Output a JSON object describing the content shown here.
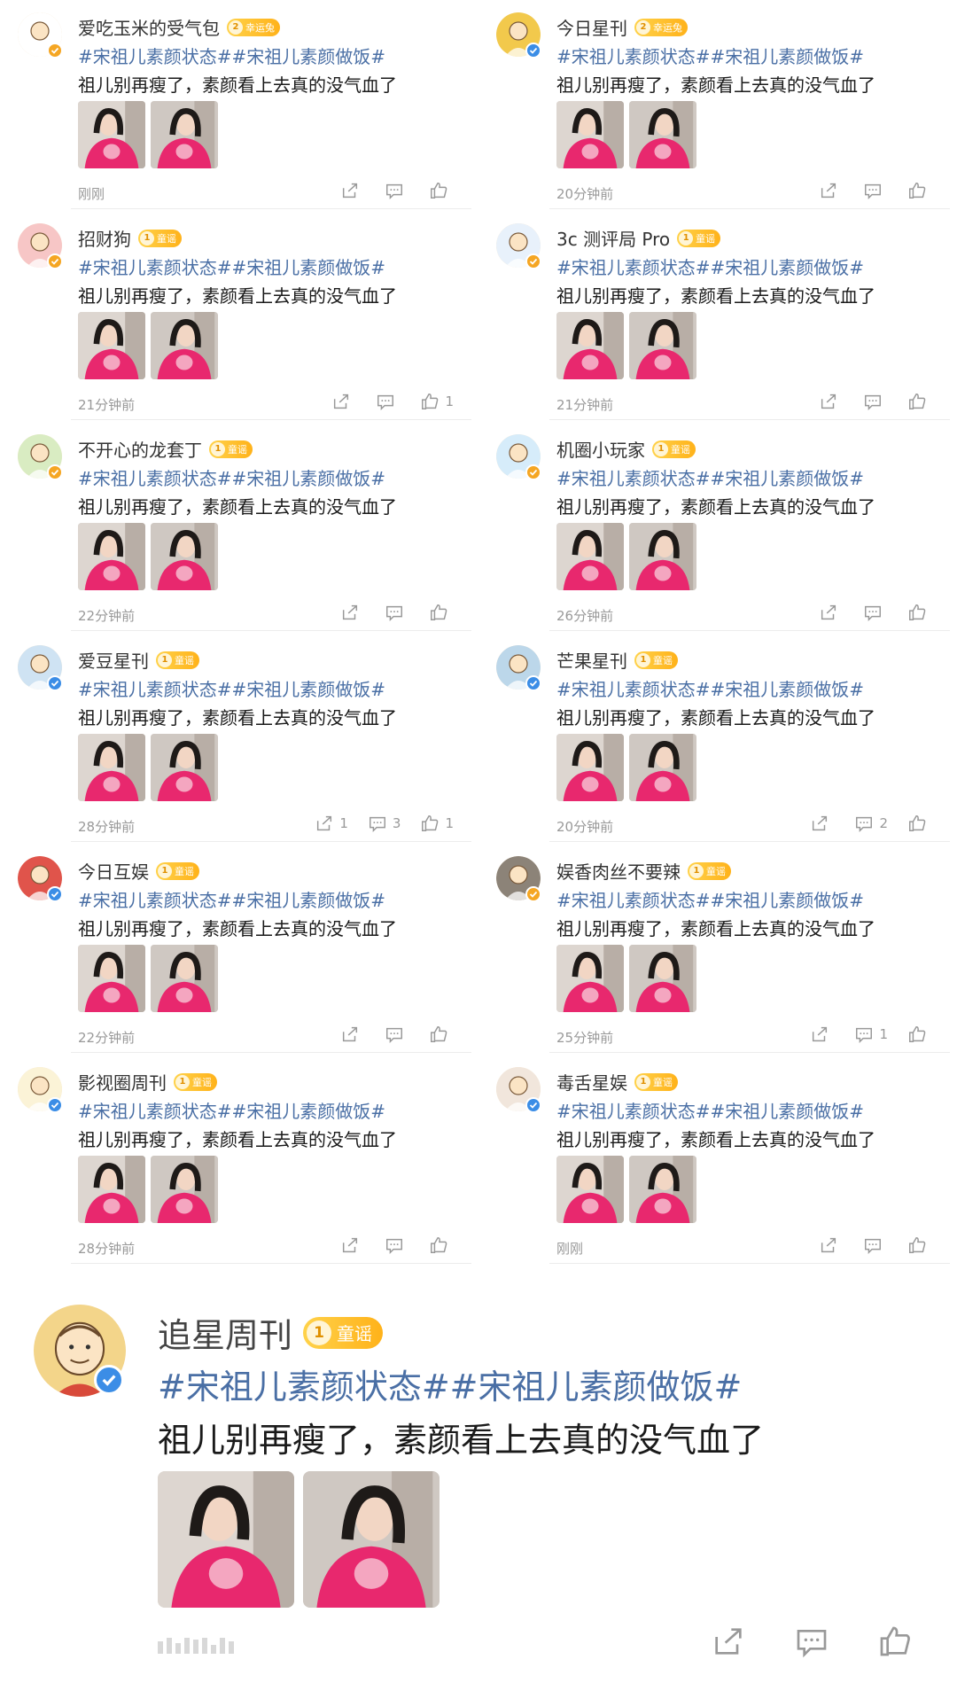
{
  "posts": [
    {
      "name": "爱吃玉米的受气包",
      "badge": "幸运兔",
      "badge_level": "2",
      "hashtags": "#宋祖儿素颜状态##宋祖儿素颜做饭#",
      "text": "祖儿别再瘦了，素颜看上去真的没气血了",
      "time": "刚刚",
      "share": "",
      "comment": "",
      "like": "",
      "avatar_color": "#ffffff",
      "verify": "gold"
    },
    {
      "name": "今日星刊",
      "badge": "幸运兔",
      "badge_level": "2",
      "hashtags": "#宋祖儿素颜状态##宋祖儿素颜做饭#",
      "text": "祖儿别再瘦了，素颜看上去真的没气血了",
      "time": "20分钟前",
      "share": "",
      "comment": "",
      "like": "",
      "avatar_color": "#f2c94c",
      "verify": "blue"
    },
    {
      "name": "招财狗",
      "badge": "童谣",
      "badge_level": "1",
      "hashtags": "#宋祖儿素颜状态##宋祖儿素颜做饭#",
      "text": "祖儿别再瘦了，素颜看上去真的没气血了",
      "time": "21分钟前",
      "share": "",
      "comment": "",
      "like": "1",
      "avatar_color": "#f7c6c6",
      "verify": "gold"
    },
    {
      "name": "3c 测评局 Pro",
      "badge": "童谣",
      "badge_level": "1",
      "hashtags": "#宋祖儿素颜状态##宋祖儿素颜做饭#",
      "text": "祖儿别再瘦了，素颜看上去真的没气血了",
      "time": "21分钟前",
      "share": "",
      "comment": "",
      "like": "",
      "avatar_color": "#e8f1fb",
      "verify": "gold"
    },
    {
      "name": "不开心的龙套丁",
      "badge": "童谣",
      "badge_level": "1",
      "hashtags": "#宋祖儿素颜状态##宋祖儿素颜做饭#",
      "text": "祖儿别再瘦了，素颜看上去真的没气血了",
      "time": "22分钟前",
      "share": "",
      "comment": "",
      "like": "",
      "avatar_color": "#d9ecc2",
      "verify": "gold"
    },
    {
      "name": "机圈小玩家",
      "badge": "童谣",
      "badge_level": "1",
      "hashtags": "#宋祖儿素颜状态##宋祖儿素颜做饭#",
      "text": "祖儿别再瘦了，素颜看上去真的没气血了",
      "time": "26分钟前",
      "share": "",
      "comment": "",
      "like": "",
      "avatar_color": "#d6ecfa",
      "verify": "gold"
    },
    {
      "name": "爱豆星刊",
      "badge": "童谣",
      "badge_level": "1",
      "hashtags": "#宋祖儿素颜状态##宋祖儿素颜做饭#",
      "text": "祖儿别再瘦了，素颜看上去真的没气血了",
      "time": "28分钟前",
      "share": "1",
      "comment": "3",
      "like": "1",
      "avatar_color": "#cfe3f3",
      "verify": "blue"
    },
    {
      "name": "芒果星刊",
      "badge": "童谣",
      "badge_level": "1",
      "hashtags": "#宋祖儿素颜状态##宋祖儿素颜做饭#",
      "text": "祖儿别再瘦了，素颜看上去真的没气血了",
      "time": "20分钟前",
      "share": "",
      "comment": "2",
      "like": "",
      "avatar_color": "#bcd7ea",
      "verify": "blue"
    },
    {
      "name": "今日互娱",
      "badge": "童谣",
      "badge_level": "1",
      "hashtags": "#宋祖儿素颜状态##宋祖儿素颜做饭#",
      "text": "祖儿别再瘦了，素颜看上去真的没气血了",
      "time": "22分钟前",
      "share": "",
      "comment": "",
      "like": "",
      "avatar_color": "#e0544b",
      "verify": "blue"
    },
    {
      "name": "娱香肉丝不要辣",
      "badge": "童谣",
      "badge_level": "1",
      "hashtags": "#宋祖儿素颜状态##宋祖儿素颜做饭#",
      "text": "祖儿别再瘦了，素颜看上去真的没气血了",
      "time": "25分钟前",
      "share": "",
      "comment": "1",
      "like": "",
      "avatar_color": "#8c8378",
      "verify": "gold"
    },
    {
      "name": "影视圈周刊",
      "badge": "童谣",
      "badge_level": "1",
      "hashtags": "#宋祖儿素颜状态##宋祖儿素颜做饭#",
      "text": "祖儿别再瘦了，素颜看上去真的没气血了",
      "time": "28分钟前",
      "share": "",
      "comment": "",
      "like": "",
      "avatar_color": "#fbf3d7",
      "verify": "blue"
    },
    {
      "name": "毒舌星娱",
      "badge": "童谣",
      "badge_level": "1",
      "hashtags": "#宋祖儿素颜状态##宋祖儿素颜做饭#",
      "text": "祖儿别再瘦了，素颜看上去真的没气血了",
      "time": "刚刚",
      "share": "",
      "comment": "",
      "like": "",
      "avatar_color": "#f1e6dc",
      "verify": "blue"
    }
  ],
  "featured": {
    "name": "追星周刊",
    "badge": "童谣",
    "badge_level": "1",
    "hashtags": "#宋祖儿素颜状态##宋祖儿素颜做饭#",
    "text": "祖儿别再瘦了，素颜看上去真的没气血了",
    "avatar_color": "#f3d58a"
  },
  "colors": {
    "hashtag": "#4a6fa5",
    "badge": "#ffc02a",
    "verify_gold": "#f5a623",
    "verify_blue": "#3b8de6",
    "shirt": "#e8286e"
  },
  "icons": [
    "share-icon",
    "comment-icon",
    "like-icon",
    "verified-icon"
  ]
}
